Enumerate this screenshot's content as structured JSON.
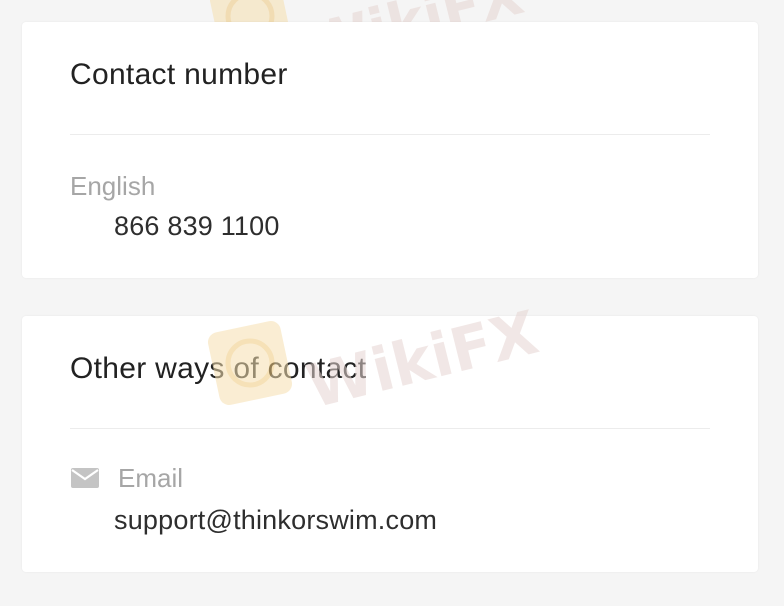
{
  "watermark": {
    "text": "WikiFX",
    "accent": "#f6d9a0",
    "text_color": "#e8d8d4"
  },
  "contact": {
    "title": "Contact number",
    "entries": [
      {
        "label": "English",
        "value": "866 839 1100"
      }
    ]
  },
  "other": {
    "title": "Other ways of contact",
    "entries": [
      {
        "icon": "envelope-icon",
        "label": "Email",
        "value": "support@thinkorswim.com"
      }
    ]
  },
  "colors": {
    "background": "#f5f5f5",
    "card": "#ffffff",
    "title": "#222222",
    "label": "#a6a6a6",
    "value": "#2e2e2e",
    "icon": "#bdbdbd"
  }
}
